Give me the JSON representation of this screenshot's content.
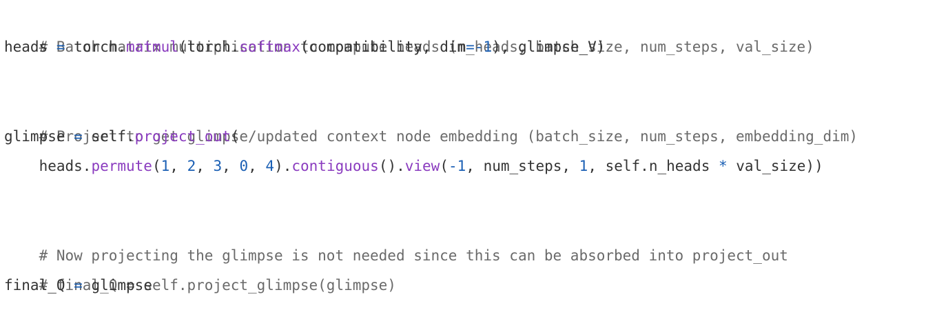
{
  "code": {
    "l1_comment": "# Batch matrix multiplication to compute heads (n_heads, batch_size, num_steps, val_size)",
    "l2": {
      "a": "heads ",
      "eq": "=",
      "b": " torch.",
      "fn1": "matmul",
      "c": "(torch.",
      "fn2": "softmax",
      "d": "(compatibility, dim",
      "eq2": "=-",
      "n1": "1",
      "e": "), glimpse_V)"
    },
    "l4_comment": "# Project to get glimpse/updated context node embedding (batch_size, num_steps, embedding_dim)",
    "l5": {
      "a": "glimpse ",
      "eq": "=",
      "b": " self.",
      "fn": "project_out",
      "c": "("
    },
    "l6": {
      "indent": "    ",
      "a": "heads.",
      "fn1": "permute",
      "b": "(",
      "n1": "1",
      "c": ", ",
      "n2": "2",
      "d": ", ",
      "n3": "3",
      "e": ", ",
      "n4": "0",
      "f": ", ",
      "n5": "4",
      "g": ").",
      "fn2": "contiguous",
      "h": "().",
      "fn3": "view",
      "i": "(",
      "neg": "-",
      "n6": "1",
      "j": ", num_steps, ",
      "n7": "1",
      "k": ", self.n_heads ",
      "star": "*",
      "l": " val_size))"
    },
    "l8_comment": "# Now projecting the glimpse is not needed since this can be absorbed into project_out",
    "l9_comment": "# final_Q = self.project_glimpse(glimpse)",
    "l10": {
      "a": "final_Q ",
      "eq": "=",
      "b": " glimpse"
    }
  }
}
